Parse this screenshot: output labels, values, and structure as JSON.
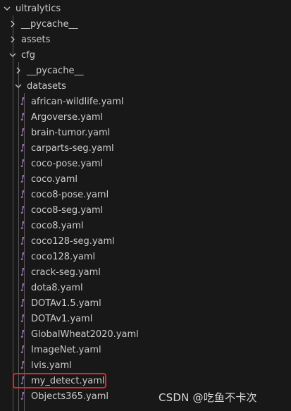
{
  "explorer": {
    "items": [
      {
        "label": "ultralytics",
        "kind": "folder-open"
      },
      {
        "label": "__pycache__",
        "kind": "folder-closed"
      },
      {
        "label": "assets",
        "kind": "folder-closed"
      },
      {
        "label": "cfg",
        "kind": "folder-open"
      },
      {
        "label": "__pycache__",
        "kind": "folder-closed"
      },
      {
        "label": "datasets",
        "kind": "folder-open"
      },
      {
        "label": "african-wildlife.yaml",
        "kind": "yaml-file"
      },
      {
        "label": "Argoverse.yaml",
        "kind": "yaml-file"
      },
      {
        "label": "brain-tumor.yaml",
        "kind": "yaml-file"
      },
      {
        "label": "carparts-seg.yaml",
        "kind": "yaml-file"
      },
      {
        "label": "coco-pose.yaml",
        "kind": "yaml-file"
      },
      {
        "label": "coco.yaml",
        "kind": "yaml-file"
      },
      {
        "label": "coco8-pose.yaml",
        "kind": "yaml-file"
      },
      {
        "label": "coco8-seg.yaml",
        "kind": "yaml-file"
      },
      {
        "label": "coco8.yaml",
        "kind": "yaml-file"
      },
      {
        "label": "coco128-seg.yaml",
        "kind": "yaml-file"
      },
      {
        "label": "coco128.yaml",
        "kind": "yaml-file"
      },
      {
        "label": "crack-seg.yaml",
        "kind": "yaml-file"
      },
      {
        "label": "dota8.yaml",
        "kind": "yaml-file"
      },
      {
        "label": "DOTAv1.5.yaml",
        "kind": "yaml-file"
      },
      {
        "label": "DOTAv1.yaml",
        "kind": "yaml-file"
      },
      {
        "label": "GlobalWheat2020.yaml",
        "kind": "yaml-file"
      },
      {
        "label": "ImageNet.yaml",
        "kind": "yaml-file"
      },
      {
        "label": "lvis.yaml",
        "kind": "yaml-file"
      },
      {
        "label": "my_detect.yaml",
        "kind": "yaml-file",
        "highlighted": true
      },
      {
        "label": "Objects365.yaml",
        "kind": "yaml-file"
      }
    ],
    "yaml_icon_glyph": "!",
    "yaml_icon_color": "#a074c4",
    "highlight_color": "#e0262a"
  },
  "watermark": {
    "text": "CSDN @吃鱼不卡次"
  }
}
